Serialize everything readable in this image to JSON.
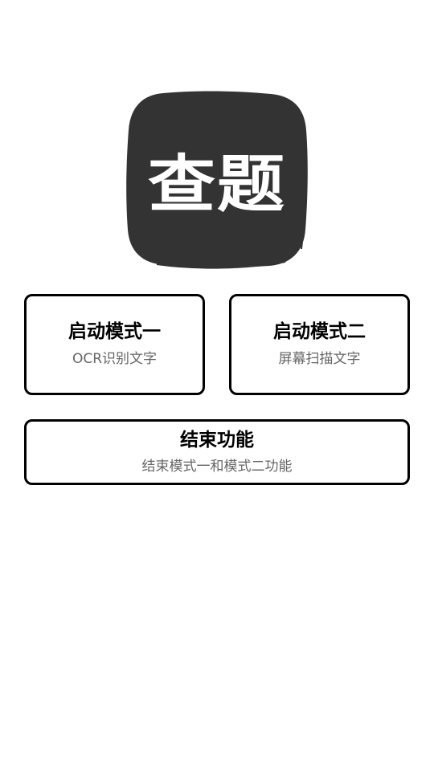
{
  "app": {
    "logo_text": "查题",
    "logo_bg_color": "#333333"
  },
  "buttons": {
    "mode_one": {
      "title": "启动模式一",
      "subtitle": "OCR识别文字"
    },
    "mode_two": {
      "title": "启动模式二",
      "subtitle": "屏幕扫描文字"
    },
    "end": {
      "title": "结束功能",
      "subtitle": "结束模式一和模式二功能"
    }
  }
}
